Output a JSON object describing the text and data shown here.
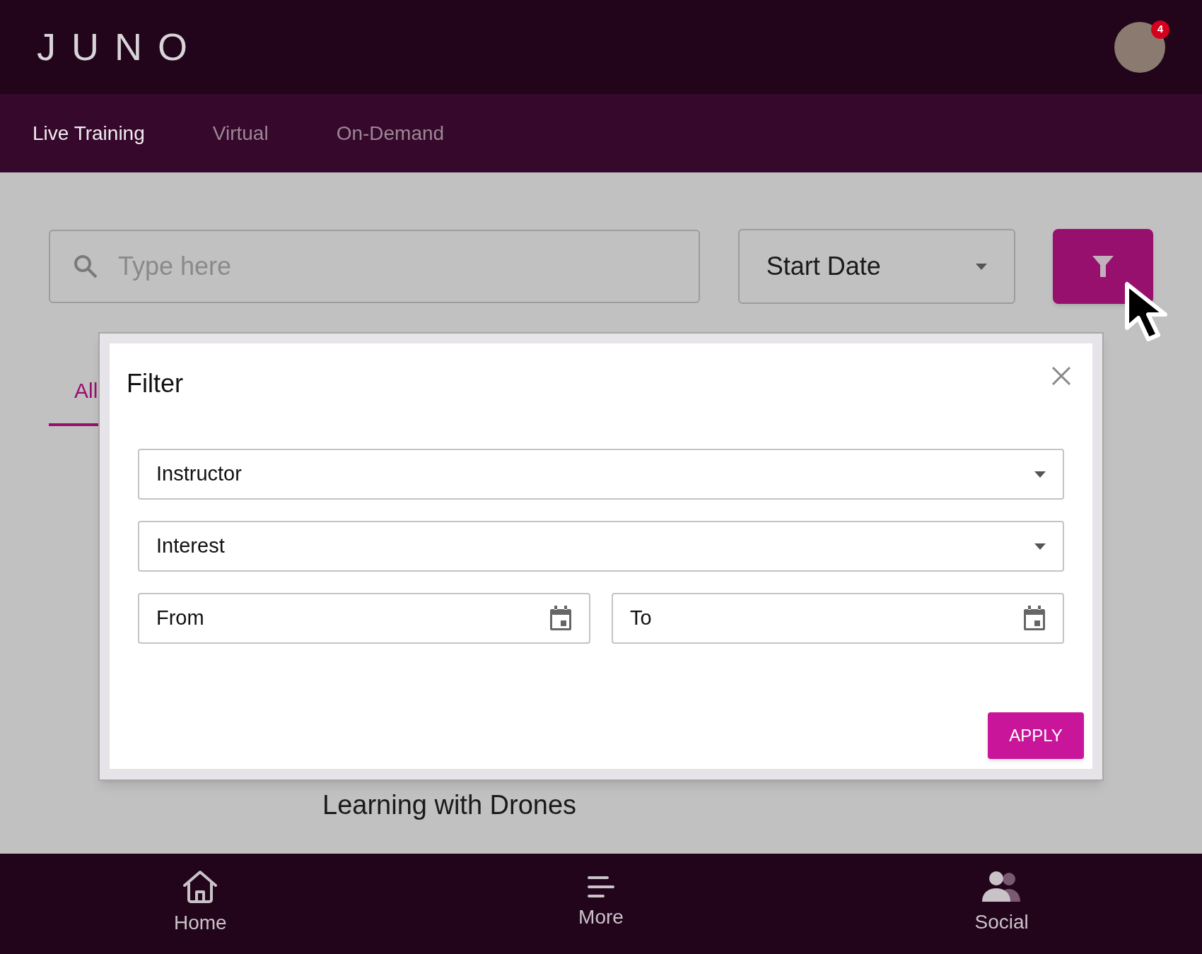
{
  "header": {
    "logo": "JUNO",
    "notification_count": "4"
  },
  "tabs": [
    {
      "label": "Live Training",
      "selected": true
    },
    {
      "label": "Virtual",
      "selected": false
    },
    {
      "label": "On-Demand",
      "selected": false
    }
  ],
  "search": {
    "placeholder": "Type here"
  },
  "sort": {
    "value": "Start Date"
  },
  "category_tabs": [
    {
      "label": "All",
      "selected": true
    }
  ],
  "course_title": "Learning with Drones",
  "filter_dialog": {
    "title": "Filter",
    "fields": [
      {
        "kind": "select",
        "placeholder": "Instructor"
      },
      {
        "kind": "select",
        "placeholder": "Interest"
      }
    ],
    "dates": [
      {
        "placeholder": "From"
      },
      {
        "placeholder": "To"
      }
    ],
    "apply": "APPLY"
  },
  "bottom_nav": [
    {
      "kind": "home",
      "label": "Home"
    },
    {
      "kind": "more",
      "label": "More"
    },
    {
      "kind": "social",
      "label": "Social"
    }
  ]
}
